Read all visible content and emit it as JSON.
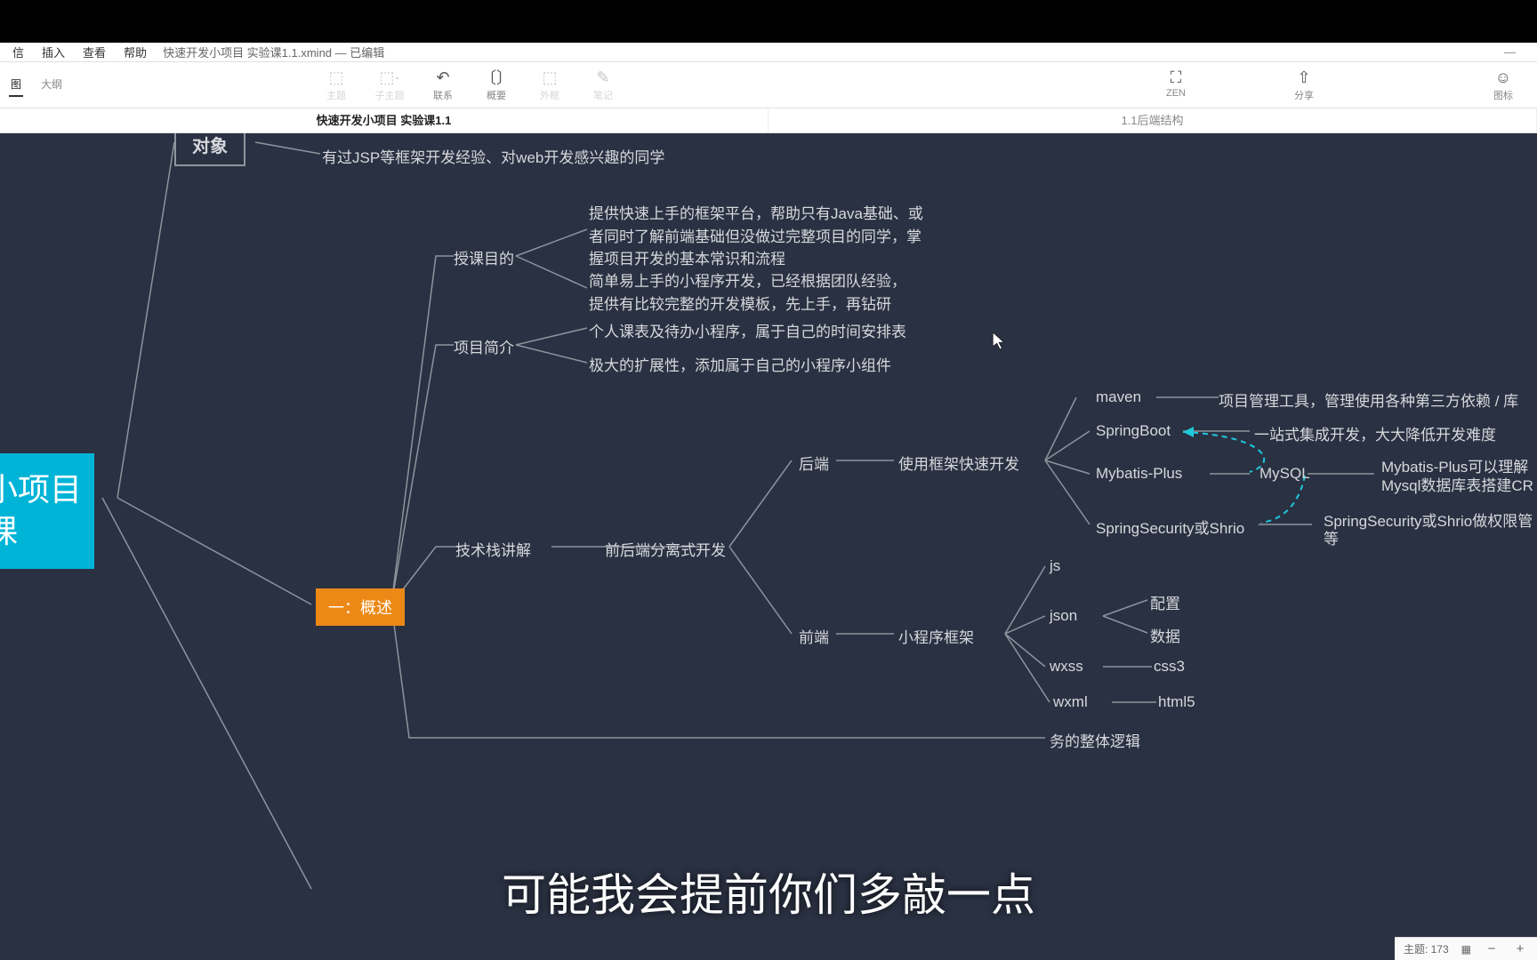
{
  "menubar": {
    "items": [
      "信",
      "插入",
      "查看",
      "帮助"
    ],
    "filename": "快速开发小项目 实验课1.1.xmind — 已编辑"
  },
  "toolbar": {
    "views": {
      "map": "图",
      "outline": "大纲"
    },
    "tools": {
      "topic": "主题",
      "subtopic": "子主题",
      "relation": "联系",
      "summary": "概要",
      "boundary": "外框",
      "note": "笔记",
      "zen": "ZEN",
      "share": "分享",
      "icon": "图标"
    }
  },
  "tabs": {
    "active": "快速开发小项目 实验课1.1",
    "other": "1.1后端结构"
  },
  "statusbar": {
    "topic_label": "主题:",
    "topic_count": "173"
  },
  "subtitle": "可能我会提前你们多敲一点",
  "nodes": {
    "root_l1": "小项目",
    "root_l2": "课",
    "target": "对象",
    "target_desc": "有过JSP等框架开发经验、对web开发感兴趣的同学",
    "purpose": "授课目的",
    "purpose_1": "提供快速上手的框架平台，帮助只有Java基础、或者同时了解前端基础但没做过完整项目的同学，掌握项目开发的基本常识和流程",
    "purpose_2": "简单易上手的小程序开发，已经根据团队经验，提供有比较完整的开发模板，先上手，再钻研",
    "intro": "项目简介",
    "intro_1": "个人课表及待办小程序，属于自己的时间安排表",
    "intro_2": "极大的扩展性，添加属于自己的小程序小组件",
    "tech": "技术栈讲解",
    "tech_sep": "前后端分离式开发",
    "backend": "后端",
    "backend_fast": "使用框架快速开发",
    "maven": "maven",
    "maven_d": "项目管理工具，管理使用各种第三方依赖 / 库",
    "springboot": "SpringBoot",
    "springboot_d": "一站式集成开发，大大降低开发难度",
    "mybatis": "Mybatis-Plus",
    "mysql": "MySQL",
    "mybatis_d1": "Mybatis-Plus可以理解",
    "mybatis_d2": "Mysql数据库表搭建CR",
    "security": "SpringSecurity或Shrio",
    "security_d1": "SpringSecurity或Shrio做权限管",
    "security_d2": "等",
    "frontend": "前端",
    "frontend_fw": "小程序框架",
    "js": "js",
    "json": "json",
    "wxss": "wxss",
    "wxml": "wxml",
    "config": "配置",
    "data": "数据",
    "css3": "css3",
    "html5": "html5",
    "logic": "务的整体逻辑",
    "section": "一：概述"
  }
}
